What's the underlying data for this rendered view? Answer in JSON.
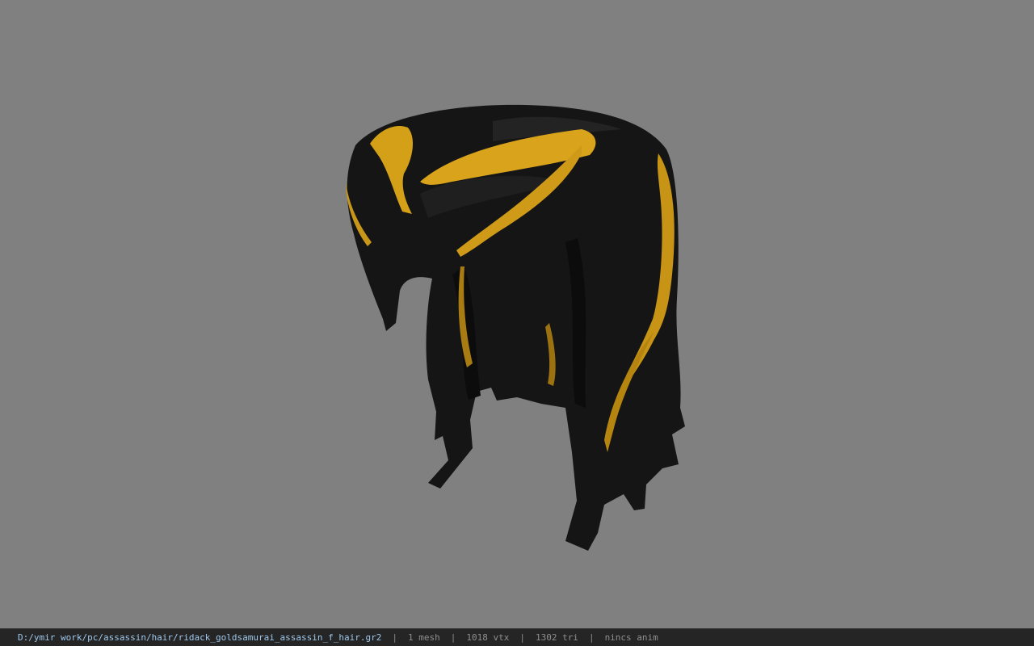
{
  "viewport": {
    "background_color": "#808080",
    "model": {
      "icon": "hair-model-3d",
      "hair_color": "#141414",
      "highlight_color": "#d4a017"
    }
  },
  "status_bar": {
    "file_path": "D:/ymir work/pc/assassin/hair/ridack_goldsamurai_assassin_f_hair.gr2",
    "separator": "|",
    "mesh_count": "1 mesh",
    "vertex_count": "1018 vtx",
    "triangle_count": "1302 tri",
    "anim_status": "nincs anim",
    "path_color": "#9ec8ec"
  }
}
